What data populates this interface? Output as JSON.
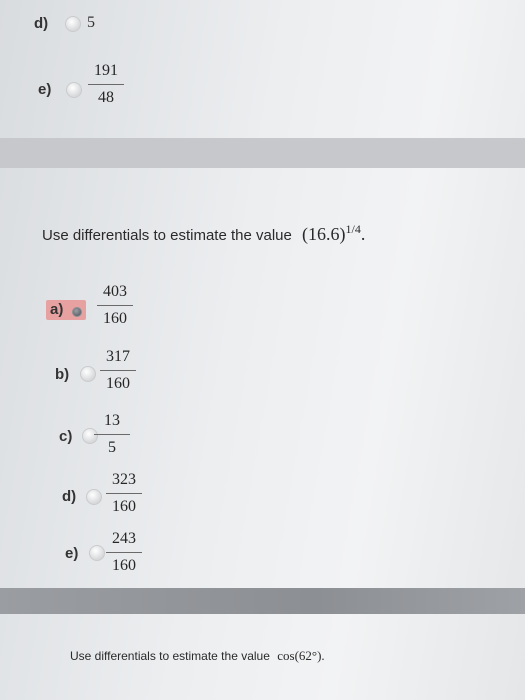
{
  "question1": {
    "options": [
      {
        "letter": "d)",
        "value": "5"
      },
      {
        "letter": "e)",
        "numerator": "191",
        "denominator": "48"
      }
    ]
  },
  "question2": {
    "prompt": "Use differentials to estimate the value",
    "expression_base": "(16.6)",
    "expression_exp": "1/4",
    "expression_end": ".",
    "options": [
      {
        "letter": "a)",
        "numerator": "403",
        "denominator": "160",
        "selected": true
      },
      {
        "letter": "b)",
        "numerator": "317",
        "denominator": "160",
        "selected": false
      },
      {
        "letter": "c)",
        "numerator": "13",
        "denominator": "5",
        "selected": false
      },
      {
        "letter": "d)",
        "numerator": "323",
        "denominator": "160",
        "selected": false
      },
      {
        "letter": "e)",
        "numerator": "243",
        "denominator": "160",
        "selected": false
      }
    ]
  },
  "question3": {
    "prompt": "Use differentials to estimate the value",
    "expression": "cos(62°)."
  },
  "colors": {
    "divider_band": "#c8cacc",
    "divider_dark": "#8f9296",
    "selected_highlight": "#e8a1a1"
  }
}
